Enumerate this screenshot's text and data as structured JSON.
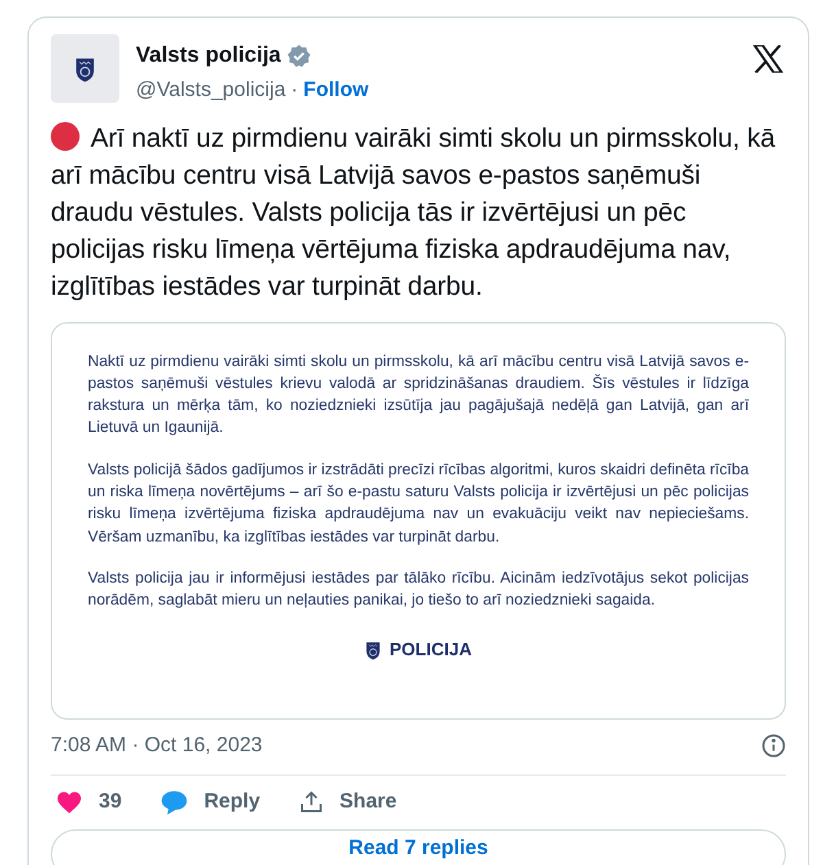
{
  "author": {
    "name": "Valsts policija",
    "verified": true,
    "handle": "@Valsts_policija",
    "separator": "·",
    "follow": "Follow"
  },
  "tweet_text": "Arī naktī uz pirmdienu vairāki simti skolu un pirmsskolu, kā arī mācību centru visā Latvijā savos e-pastos saņēmuši draudu vēstules. Valsts policija tās ir izvērtējusi un pēc policijas risku līmeņa vērtējuma fiziska apdraudējuma nav, izglītības iestādes var turpināt darbu.",
  "document": {
    "paragraphs": [
      "Naktī uz pirmdienu vairāki simti skolu un pirmsskolu, kā arī mācību centru visā Latvijā savos e-pastos saņēmuši vēstules krievu valodā ar spridzināšanas draudiem. Šīs vēstules ir līdzīga rakstura un mērķa tām, ko noziedznieki izsūtīja jau pagājušajā nedēļā gan Latvijā, gan arī Lietuvā un Igaunijā.",
      "Valsts policijā šādos gadījumos ir izstrādāti precīzi rīcības algoritmi, kuros skaidri definēta rīcība un riska līmeņa novērtējums – arī šo e-pastu saturu Valsts policija ir izvērtējusi un pēc policijas risku līmeņa izvērtējuma fiziska apdraudējuma nav un evakuāciju veikt nav nepieciešams. Vēršam uzmanību, ka izglītības iestādes var turpināt darbu.",
      "Valsts policija jau ir informējusi iestādes par tālāko rīcību. Aicinām iedzīvotājus sekot policijas norādēm, saglabāt mieru un neļauties panikai, jo tiešo to arī noziedznieki sagaida."
    ],
    "logo_text": "POLICIJA"
  },
  "timestamp": "7:08 AM · Oct 16, 2023",
  "actions": [
    {
      "kind": "like",
      "label": "39"
    },
    {
      "kind": "reply",
      "label": "Reply"
    },
    {
      "kind": "share",
      "label": "Share"
    }
  ],
  "read_replies": "Read 7 replies"
}
